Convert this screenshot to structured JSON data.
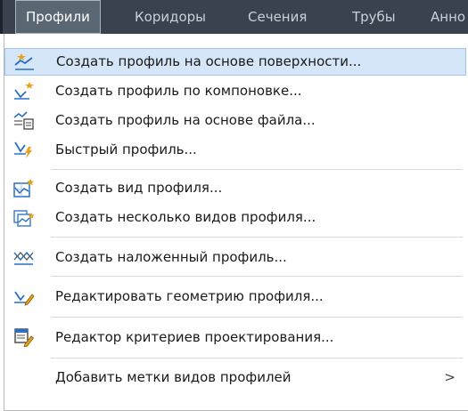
{
  "menubar": {
    "items": [
      {
        "label": "Профили",
        "active": true
      },
      {
        "label": "Коридоры"
      },
      {
        "label": "Сечения"
      },
      {
        "label": "Трубы"
      },
      {
        "label": "Анно"
      }
    ]
  },
  "menu": {
    "items": [
      {
        "label": "Создать профиль на основе поверхности...",
        "icon": "profile-from-surface-icon",
        "highlighted": true
      },
      {
        "label": "Создать профиль по компоновке...",
        "icon": "profile-by-layout-icon"
      },
      {
        "label": "Создать профиль на основе файла...",
        "icon": "profile-from-file-icon"
      },
      {
        "label": "Быстрый профиль...",
        "icon": "quick-profile-icon"
      },
      {
        "label": "Создать вид профиля...",
        "icon": "create-profile-view-icon"
      },
      {
        "label": "Создать несколько видов профиля...",
        "icon": "create-multiple-profile-views-icon"
      },
      {
        "label": "Создать наложенный профиль...",
        "icon": "superimposed-profile-icon"
      },
      {
        "label": "Редактировать геометрию профиля...",
        "icon": "edit-profile-geometry-icon"
      },
      {
        "label": "Редактор критериев проектирования...",
        "icon": "design-criteria-editor-icon"
      },
      {
        "label": "Добавить метки видов профилей",
        "submenu_indicator": ">"
      }
    ]
  },
  "colors": {
    "menubar_bg": "#39424e",
    "highlight_bg": "#d4e6f7",
    "icon_blue": "#2a6fc4",
    "icon_yellow": "#e8a21a"
  }
}
